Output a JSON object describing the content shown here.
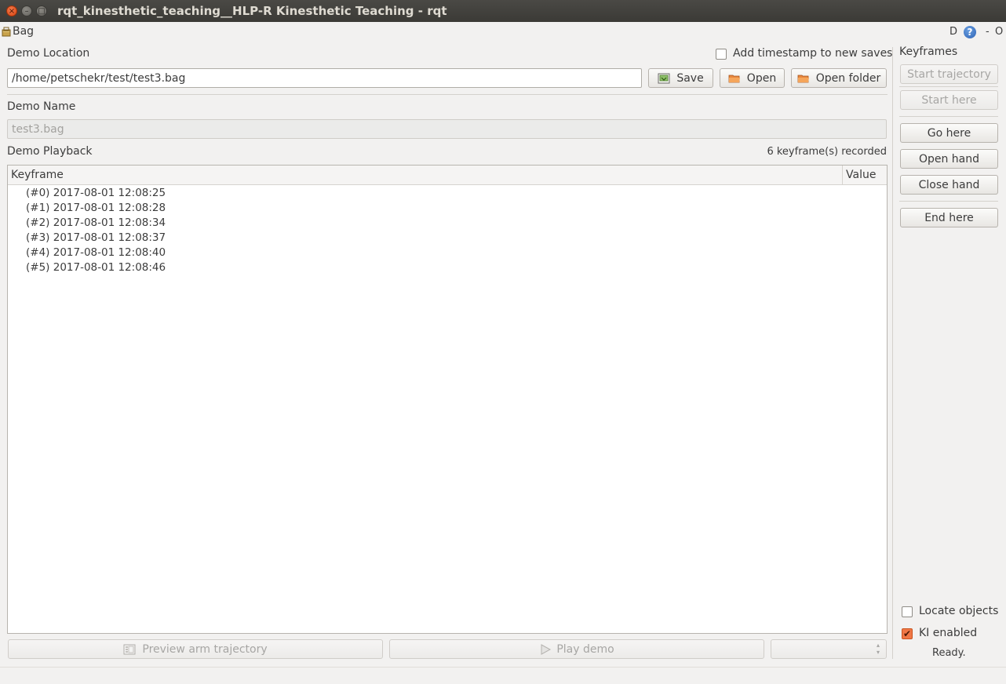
{
  "window": {
    "title": "rqt_kinesthetic_teaching__HLP-R Kinesthetic Teaching - rqt",
    "close_glyph": "×",
    "minimize_glyph": "–",
    "maximize_glyph": "□"
  },
  "plugin": {
    "title": "Bag",
    "d_label": "D",
    "help_glyph": "?",
    "dash_glyph": "-",
    "o_glyph": "O"
  },
  "demo_location": {
    "label": "Demo Location",
    "path": "/home/petschekr/test/test3.bag",
    "timestamp_label": "Add timestamp to new saves",
    "save_label": "Save",
    "open_label": "Open",
    "open_folder_label": "Open folder"
  },
  "demo_name": {
    "label": "Demo Name",
    "value": "test3.bag"
  },
  "playback": {
    "label": "Demo Playback",
    "count_text": "6 keyframe(s) recorded",
    "columns": [
      "Keyframe",
      "Value"
    ],
    "rows": [
      "(#0) 2017-08-01 12:08:25",
      "(#1) 2017-08-01 12:08:28",
      "(#2) 2017-08-01 12:08:34",
      "(#3) 2017-08-01 12:08:37",
      "(#4) 2017-08-01 12:08:40",
      "(#5) 2017-08-01 12:08:46"
    ],
    "preview_label": "Preview arm trajectory",
    "play_label": "Play demo",
    "spin_up": "▴",
    "spin_down": "▾"
  },
  "keyframes": {
    "title": "Keyframes",
    "start_trajectory": "Start trajectory",
    "start_here": "Start here",
    "go_here": "Go here",
    "open_hand": "Open hand",
    "close_hand": "Close hand",
    "end_here": "End here"
  },
  "options": {
    "locate_objects_label": "Locate objects",
    "locate_objects_checked": false,
    "ki_enabled_label": "KI enabled",
    "ki_enabled_checked": true,
    "check_glyph": "✔",
    "status": "Ready."
  },
  "colors": {
    "accent": "#f07746",
    "titlebar": "#3b3a36",
    "background": "#f2f1f0"
  }
}
